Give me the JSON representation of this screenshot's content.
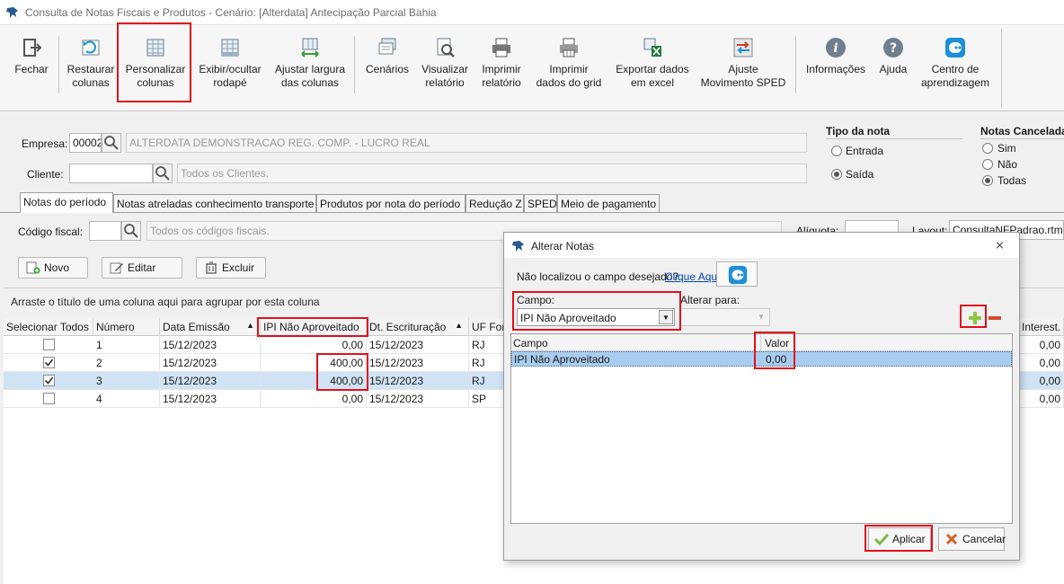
{
  "window": {
    "title": "Consulta de Notas Fiscais e Produtos - Cenário: [Alterdata] Antecipação Parcial Bahia"
  },
  "toolbar": {
    "fechar": "Fechar",
    "restaurar": "Restaurar\ncolunas",
    "personalizar": "Personalizar\ncolunas",
    "exibir": "Exibir/ocultar\nrodapé",
    "ajustar": "Ajustar largura\ndas colunas",
    "cenarios": "Cenários",
    "visualizar": "Visualizar\nrelatório",
    "imprimir_rel": "Imprimir\nrelatório",
    "imprimir_grid": "Imprimir\ndados do grid",
    "exportar": "Exportar dados\nem excel",
    "ajuste_sped": "Ajuste\nMovimento SPED",
    "informacoes": "Informações",
    "ajuda": "Ajuda",
    "centro": "Centro de\naprendizagem"
  },
  "filters": {
    "empresa_label": "Empresa:",
    "empresa_code": "00002",
    "empresa_name": "ALTERDATA DEMONSTRACAO REG. COMP. - LUCRO REAL",
    "cliente_label": "Cliente:",
    "cliente_value": "",
    "cliente_placeholder": "Todos os Clientes.",
    "tipo_nota_title": "Tipo da nota",
    "tipo_entrada": "Entrada",
    "tipo_saida": "Saída",
    "canceladas_title": "Notas Canceladas",
    "cancel_sim": "Sim",
    "cancel_nao": "Não",
    "cancel_todas": "Todas",
    "codigo_fiscal_label": "Código fiscal:",
    "codigo_fiscal_placeholder": "Todos os códigos fiscais.",
    "aliquota_label": "Alíquota:",
    "layout_label": "Layout:",
    "layout_value": "ConsultaNFPadrao.rtm"
  },
  "tabs": [
    "Notas do período",
    "Notas atreladas conhecimento transporte",
    "Produtos por nota do período",
    "Redução Z",
    "SPED",
    "Meio de pagamento"
  ],
  "actions": {
    "novo": "Novo",
    "editar": "Editar",
    "excluir": "Excluir"
  },
  "grid": {
    "group_hint": "Arraste o título de uma coluna aqui para agrupar por esta coluna",
    "headers": [
      "Selecionar Todos",
      "Número",
      "Data Emissão",
      "IPI Não Aproveitado",
      "Dt. Escrituração",
      "UF For",
      "Interest. A"
    ],
    "rows": [
      {
        "checked": false,
        "numero": "1",
        "data": "15/12/2023",
        "ipi": "0,00",
        "dt": "15/12/2023",
        "uf": "RJ",
        "interest": "0,00"
      },
      {
        "checked": true,
        "numero": "2",
        "data": "15/12/2023",
        "ipi": "400,00",
        "dt": "15/12/2023",
        "uf": "RJ",
        "interest": "0,00"
      },
      {
        "checked": true,
        "numero": "3",
        "data": "15/12/2023",
        "ipi": "400,00",
        "dt": "15/12/2023",
        "uf": "RJ",
        "interest": "0,00"
      },
      {
        "checked": false,
        "numero": "4",
        "data": "15/12/2023",
        "ipi": "0,00",
        "dt": "15/12/2023",
        "uf": "SP",
        "interest": "0,00"
      }
    ]
  },
  "dialog": {
    "title": "Alterar Notas",
    "not_found_text": "Não localizou o campo desejado?",
    "click_here": "Clique Aqui",
    "campo_label": "Campo:",
    "campo_value": "IPI Não Aproveitado",
    "alterar_label": "Alterar para:",
    "alterar_value": "",
    "list_headers": [
      "Campo",
      "Valor"
    ],
    "list_rows": [
      {
        "campo": "IPI Não Aproveitado",
        "valor": "0,00"
      }
    ],
    "aplicar": "Aplicar",
    "cancelar": "Cancelar"
  },
  "colors": {
    "highlight": "#e0101e",
    "selected_row": "#cfe3f5",
    "accent_blue": "#1d8fd8"
  }
}
